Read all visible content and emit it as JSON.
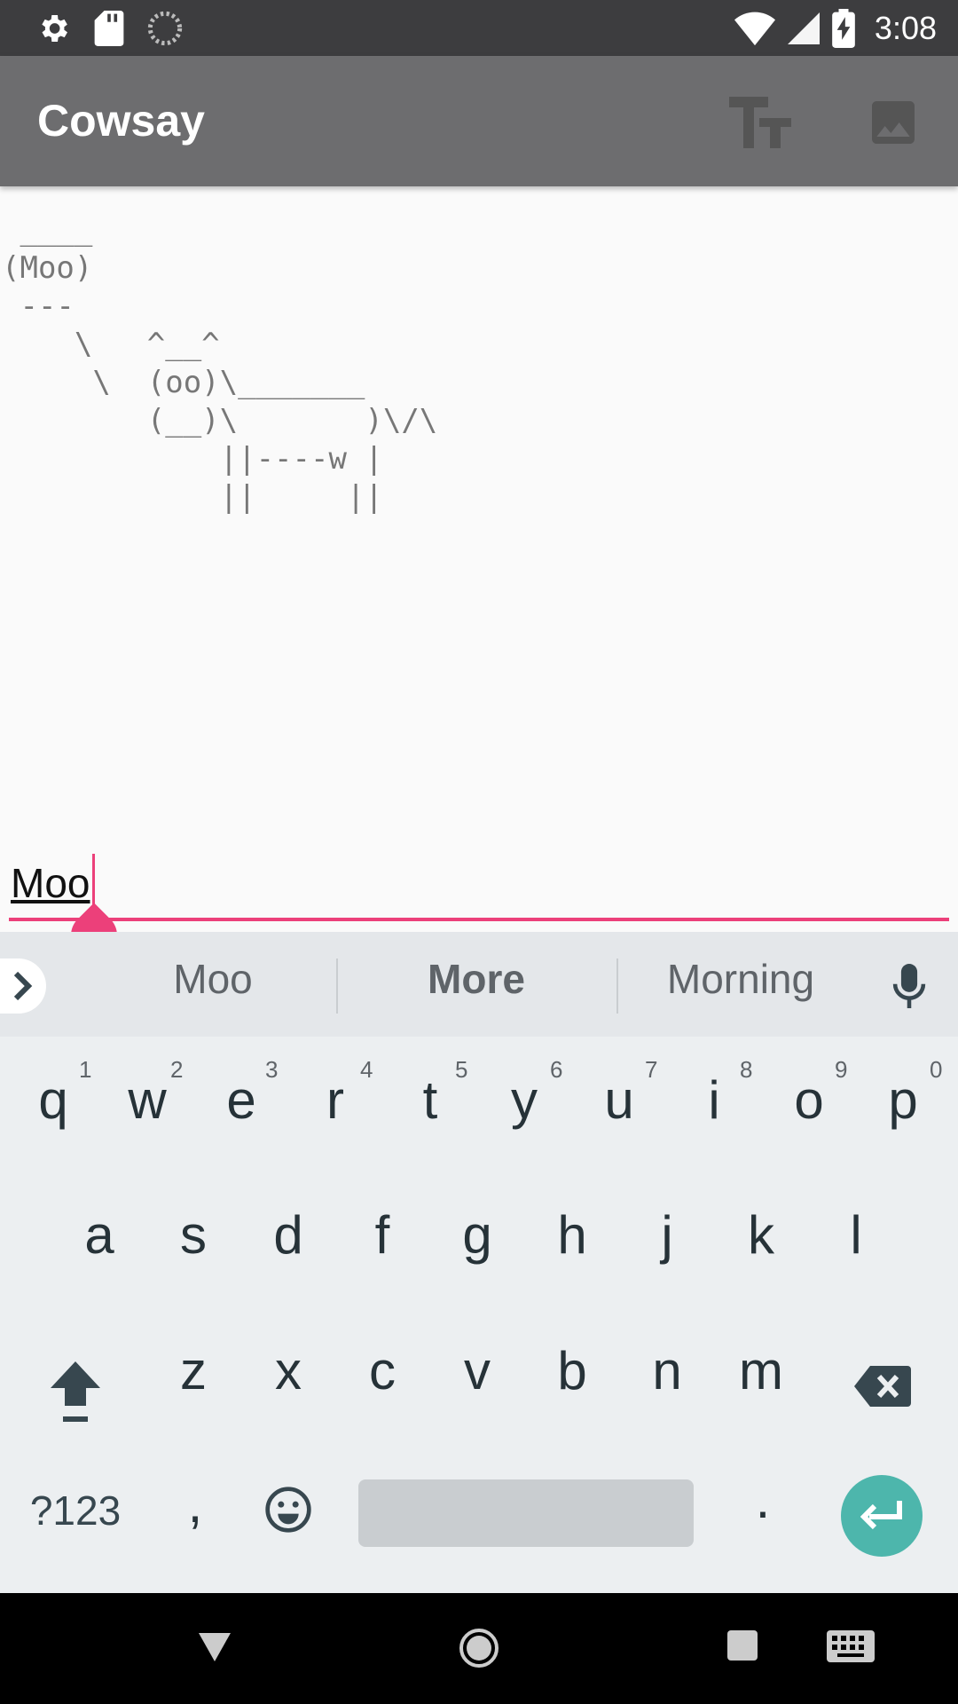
{
  "status_bar": {
    "time": "3:08"
  },
  "app_bar": {
    "title": "Cowsay",
    "text_size_icon": "text-size-icon",
    "image_icon": "image-icon"
  },
  "cow": {
    "art": " ____\n(Moo)\n ---\n    \\   ^__^\n     \\  (oo)\\_______\n        (__)\\       )\\/\\\n            ||----w |\n            ||     ||"
  },
  "input": {
    "value": "Moo"
  },
  "suggestions": [
    "Moo",
    "More",
    "Morning"
  ],
  "keyboard": {
    "row1": [
      {
        "key": "q",
        "hint": "1"
      },
      {
        "key": "w",
        "hint": "2"
      },
      {
        "key": "e",
        "hint": "3"
      },
      {
        "key": "r",
        "hint": "4"
      },
      {
        "key": "t",
        "hint": "5"
      },
      {
        "key": "y",
        "hint": "6"
      },
      {
        "key": "u",
        "hint": "7"
      },
      {
        "key": "i",
        "hint": "8"
      },
      {
        "key": "o",
        "hint": "9"
      },
      {
        "key": "p",
        "hint": "0"
      }
    ],
    "row2": [
      "a",
      "s",
      "d",
      "f",
      "g",
      "h",
      "j",
      "k",
      "l"
    ],
    "row3": [
      "z",
      "x",
      "c",
      "v",
      "b",
      "n",
      "m"
    ],
    "symbols_label": "?123",
    "comma": ",",
    "period": "."
  },
  "colors": {
    "accent": "#ec407a",
    "app_bar": "#6d6d6f",
    "status_bar": "#3d3d3f",
    "enter": "#4db6ac"
  }
}
